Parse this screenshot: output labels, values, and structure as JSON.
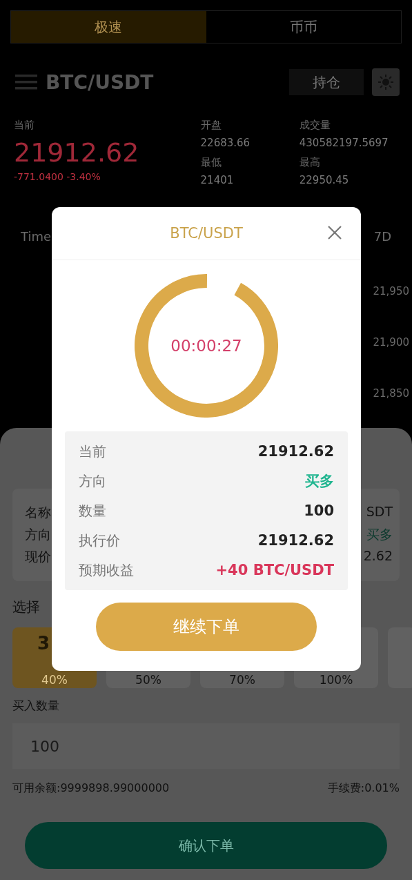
{
  "mode_tabs": [
    {
      "label": "极速",
      "selected": true
    },
    {
      "label": "币币",
      "selected": false
    }
  ],
  "header": {
    "pair": "BTC/USDT",
    "position_button": "持仓"
  },
  "stats": {
    "current_label": "当前",
    "current_price": "21912.62",
    "change": "-771.0400 -3.40%",
    "columns": [
      [
        {
          "label": "开盘",
          "value": "22683.66"
        },
        {
          "label": "最低",
          "value": "21401"
        }
      ],
      [
        {
          "label": "成交量",
          "value": "430582197.5697"
        },
        {
          "label": "最高",
          "value": "22950.45"
        }
      ]
    ]
  },
  "chart": {
    "tab_left": "Time",
    "tab_right": "7D",
    "price_labels": [
      "21,950",
      "21,900",
      "21,850"
    ]
  },
  "order_sheet": {
    "summary": [
      {
        "label": "名称",
        "value": "SDT",
        "kind": "plain"
      },
      {
        "label": "方向",
        "value": "买多",
        "kind": "up"
      },
      {
        "label": "现价",
        "value": "2.62",
        "kind": "plain"
      }
    ],
    "period_label": "选择",
    "periods": [
      {
        "time": "3",
        "rate": "40%",
        "selected": true
      },
      {
        "rate": "50%",
        "selected": false
      },
      {
        "rate": "70%",
        "selected": false
      },
      {
        "rate": "100%",
        "selected": false
      },
      {
        "selected": false
      }
    ],
    "amount_label": "买入数量",
    "amount_value": "100",
    "balance": "可用余额:9999898.99000000",
    "fee": "手续费:0.01%",
    "confirm_button": "确认下单"
  },
  "dialog": {
    "title": "BTC/USDT",
    "countdown": "00:00:27",
    "ring": {
      "level": 0.92
    },
    "rows": [
      {
        "label": "当前",
        "value": "21912.62",
        "kind": "plain"
      },
      {
        "label": "方向",
        "value": "买多",
        "kind": "up"
      },
      {
        "label": "数量",
        "value": "100",
        "kind": "plain"
      },
      {
        "label": "执行价",
        "value": "21912.62",
        "kind": "plain"
      },
      {
        "label": "预期收益",
        "value": "+40 BTC/USDT",
        "kind": "profit"
      }
    ],
    "continue_button": "继续下单"
  }
}
